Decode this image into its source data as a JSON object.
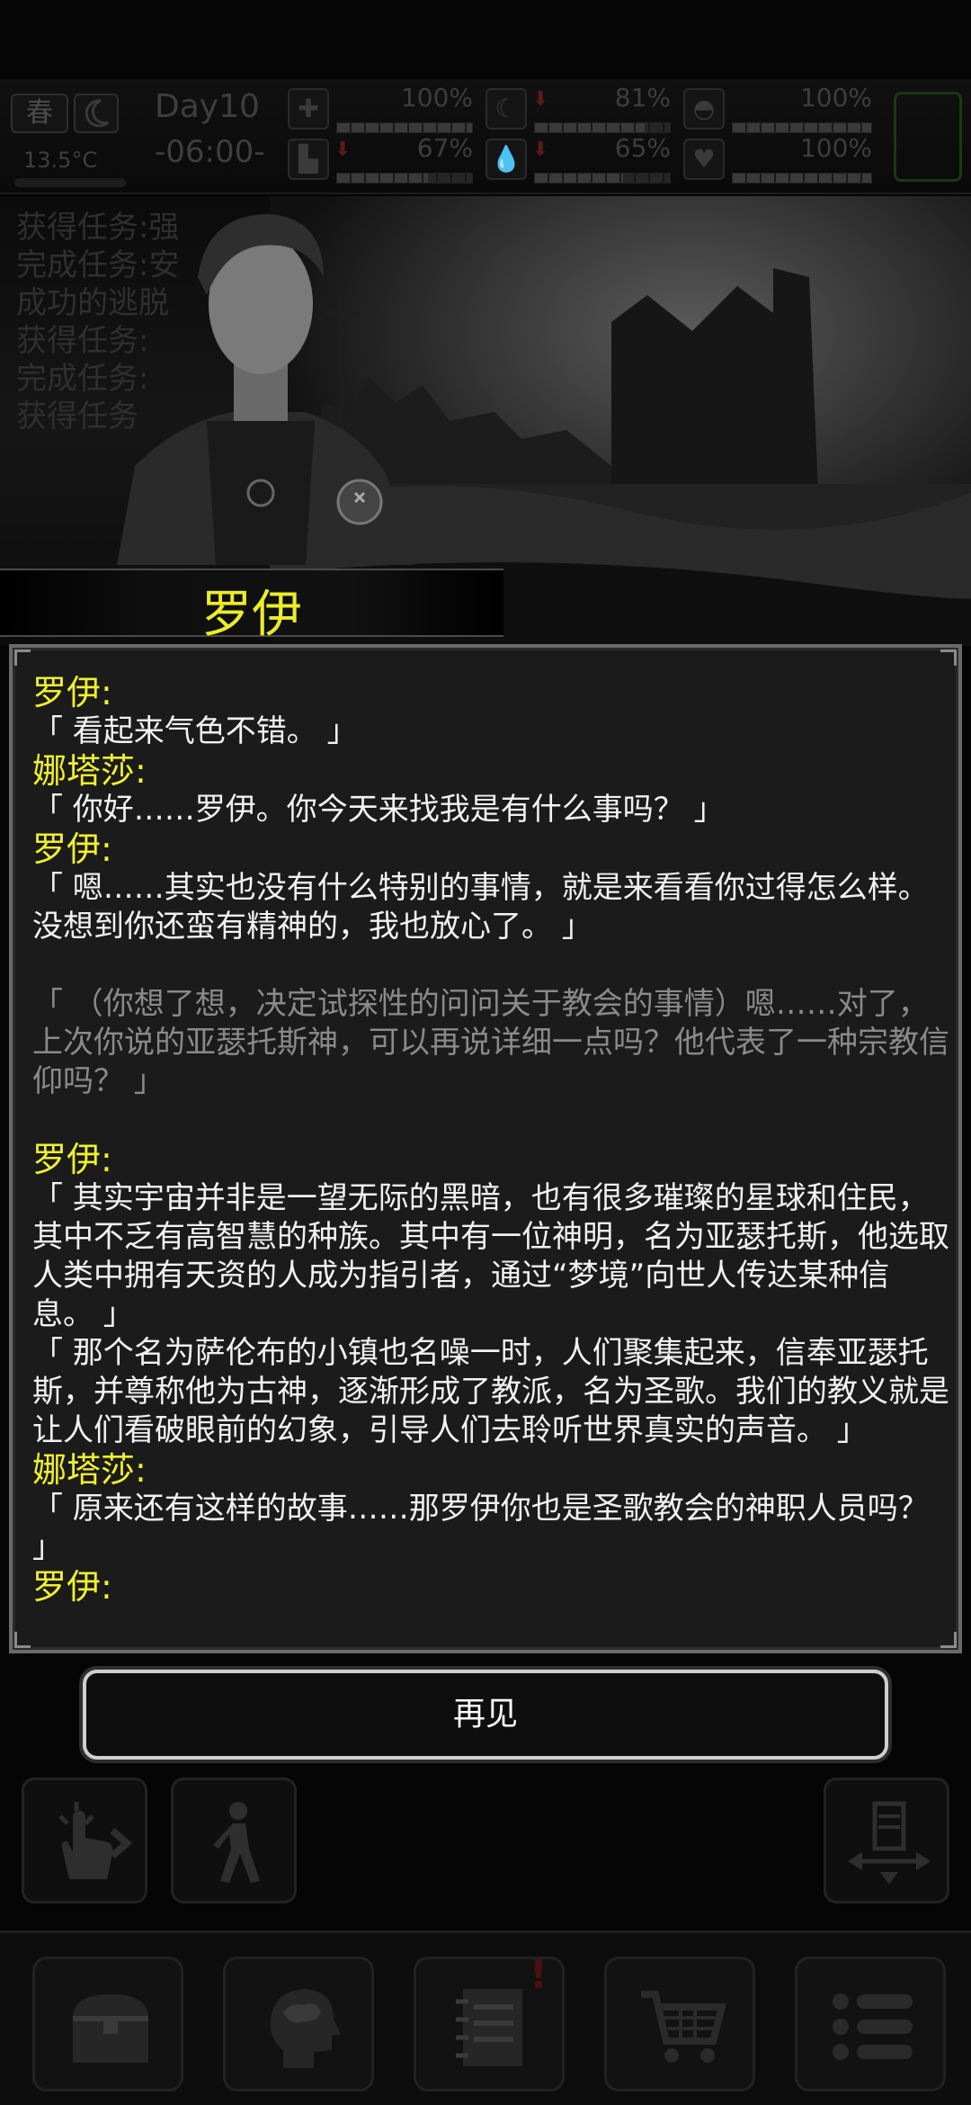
{
  "status": {
    "season": "春",
    "temperature": "13.5°C",
    "day": "Day10",
    "time": "-06:00-",
    "stats": [
      {
        "name": "health",
        "icon": "medkit-icon",
        "value": "100%",
        "fill": 1.0
      },
      {
        "name": "hunger",
        "icon": "stomach-icon",
        "value": "81%",
        "fill": 0.81
      },
      {
        "name": "armor",
        "icon": "helmet-icon",
        "value": "100%",
        "fill": 1.0
      },
      {
        "name": "stamina",
        "icon": "boot-icon",
        "value": "67%",
        "fill": 0.67
      },
      {
        "name": "thirst",
        "icon": "drop-icon",
        "value": "65%",
        "fill": 0.65
      },
      {
        "name": "mood",
        "icon": "heart-icon",
        "value": "100%",
        "fill": 1.0
      }
    ]
  },
  "log": [
    "获得任务:强",
    "完成任务:安",
    "成功的逃脱",
    "获得任务:",
    "完成任务:",
    "获得任务"
  ],
  "npc": {
    "name": "罗伊"
  },
  "dialog": [
    {
      "speaker": "罗伊:",
      "text": "「 看起来气色不错。 」"
    },
    {
      "speaker": "娜塔莎:",
      "text": "「 你好……罗伊。你今天来找我是有什么事吗？ 」"
    },
    {
      "speaker": "罗伊:",
      "text": "「 嗯……其实也没有什么特别的事情，就是来看看你过得怎么样。没想到你还蛮有精神的，我也放心了。 」"
    },
    {
      "speaker": "",
      "text": "「 （你想了想，决定试探性的问问关于教会的事情）嗯……对了，上次你说的亚瑟托斯神，可以再说详细一点吗？他代表了一种宗教信仰吗？ 」",
      "style": "gray"
    },
    {
      "speaker": "罗伊:",
      "text": "「 其实宇宙并非是一望无际的黑暗，也有很多璀璨的星球和住民，其中不乏有高智慧的种族。其中有一位神明，名为亚瑟托斯，他选取人类中拥有天资的人成为指引者，通过“梦境”向世人传达某种信息。 」"
    },
    {
      "speaker": "",
      "text": "「 那个名为萨伦布的小镇也名噪一时，人们聚集起来，信奉亚瑟托斯，并尊称他为古神，逐渐形成了教派，名为圣歌。我们的教义就是让人们看破眼前的幻象，引导人们去聆听世界真实的声音。 」"
    },
    {
      "speaker": "娜塔莎:",
      "text": "「 原来还有这样的故事……那罗伊你也是圣歌教会的神职人员吗？ 」"
    },
    {
      "speaker": "罗伊:",
      "text": ""
    }
  ],
  "buttons": {
    "goodbye": "再见"
  },
  "colors": {
    "speaker": "#f0f030",
    "dialog_bg": "#1b1b1b",
    "text": "#f2f2f2",
    "narration": "#8a8a8a"
  }
}
